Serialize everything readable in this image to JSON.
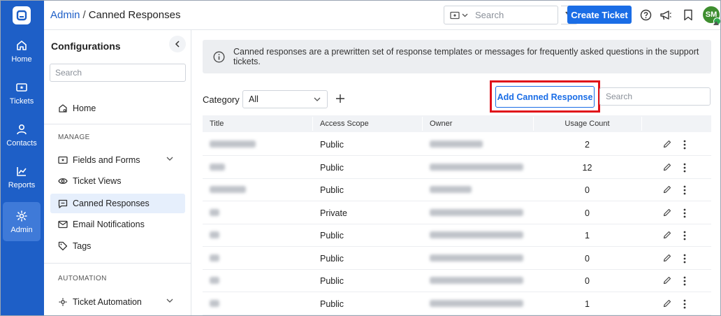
{
  "rail": {
    "items": [
      {
        "label": "Home",
        "icon": "home-icon"
      },
      {
        "label": "Tickets",
        "icon": "ticket-icon"
      },
      {
        "label": "Contacts",
        "icon": "contact-icon"
      },
      {
        "label": "Reports",
        "icon": "chart-icon"
      },
      {
        "label": "Admin",
        "icon": "gear-icon",
        "active": true
      }
    ]
  },
  "header": {
    "breadcrumb_link": "Admin",
    "separator": "/",
    "breadcrumb_current": "Canned Responses",
    "search_placeholder": "Search",
    "create_button": "Create Ticket",
    "avatar_initials": "SM"
  },
  "panel": {
    "title": "Configurations",
    "search_placeholder": "Search",
    "home_label": "Home",
    "section_manage": "MANAGE",
    "items": [
      {
        "label": "Fields and Forms",
        "icon": "ticket-icon",
        "expandable": true
      },
      {
        "label": "Ticket Views",
        "icon": "eye-icon"
      },
      {
        "label": "Canned Responses",
        "icon": "message-icon",
        "active": true
      },
      {
        "label": "Email Notifications",
        "icon": "mail-icon"
      },
      {
        "label": "Tags",
        "icon": "tag-icon"
      }
    ],
    "section_automation": "AUTOMATION",
    "automation_item": "Ticket Automation"
  },
  "main": {
    "info_text": "Canned responses are a prewritten set of response templates or messages for frequently asked questions in the support tickets.",
    "category_label": "Category",
    "category_value": "All",
    "add_button": "Add Canned Response",
    "search_placeholder": "Search",
    "columns": [
      "Title",
      "Access Scope",
      "Owner",
      "Usage Count"
    ],
    "rows": [
      {
        "scope": "Public",
        "usage": "2"
      },
      {
        "scope": "Public",
        "usage": "12"
      },
      {
        "scope": "Public",
        "usage": "0"
      },
      {
        "scope": "Private",
        "usage": "0"
      },
      {
        "scope": "Public",
        "usage": "1"
      },
      {
        "scope": "Public",
        "usage": "0"
      },
      {
        "scope": "Public",
        "usage": "0"
      },
      {
        "scope": "Public",
        "usage": "1"
      }
    ]
  },
  "colors": {
    "brand": "#1e5fc7",
    "primary_button": "#1a6de6",
    "highlight": "#e0111a"
  }
}
